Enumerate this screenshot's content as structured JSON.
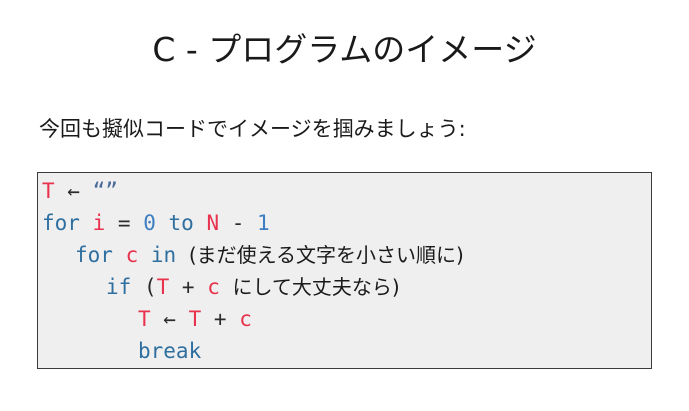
{
  "slide": {
    "title": "C - プログラムのイメージ",
    "intro": "今回も擬似コードでイメージを掴みましょう:"
  },
  "code": {
    "line1": {
      "var": "T",
      "arrow": " ← ",
      "value": "“”"
    },
    "line2": {
      "for": "for",
      "var": "i",
      "eq": " = ",
      "start": "0",
      "to": "to",
      "end_var": "N",
      "minus": " - ",
      "end_num": "1"
    },
    "line3": {
      "for": "for",
      "var": "c",
      "in": "in",
      "desc": "(まだ使える文字を小さい順に)"
    },
    "line4": {
      "if": "if",
      "open": "(",
      "var_t": "T",
      "plus": " + ",
      "var_c": "c",
      "desc": "にして大丈夫なら)"
    },
    "line5": {
      "var_t": "T",
      "arrow": " ← ",
      "var_t2": "T",
      "plus": " + ",
      "var_c": "c"
    },
    "line6": {
      "break": "break"
    }
  }
}
